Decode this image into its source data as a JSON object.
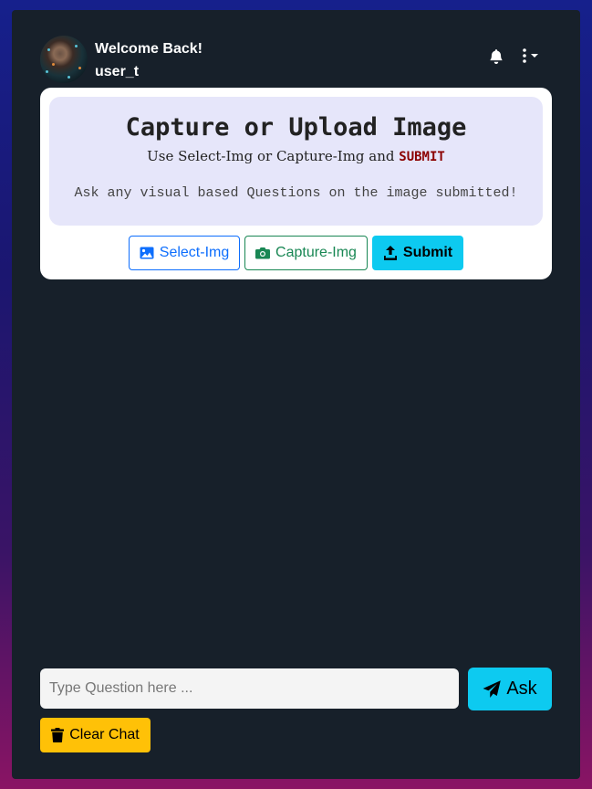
{
  "header": {
    "welcome": "Welcome Back!",
    "username": "user_t",
    "avatar_icon": "user-portrait-avatar",
    "notifications_icon": "bell-icon",
    "menu_icon": "kebab-dropdown-icon"
  },
  "card": {
    "title": "Capture or Upload Image",
    "subtitle_prefix": "Use Select-Img or Capture-Img and ",
    "subtitle_keyword": "SUBMIT",
    "hint": "Ask any visual based Questions on the image submitted!",
    "buttons": {
      "select": {
        "label": "Select-Img",
        "icon": "image-icon",
        "color": "#0d6efd"
      },
      "capture": {
        "label": "Capture-Img",
        "icon": "camera-icon",
        "color": "#198754"
      },
      "submit": {
        "label": "Submit",
        "icon": "upload-icon",
        "color": "#0dcaf0"
      }
    }
  },
  "chat": {
    "question_placeholder": "Type Question here ...",
    "question_value": "",
    "ask_label": "Ask",
    "ask_icon": "paper-plane-icon",
    "clear_label": "Clear Chat",
    "clear_icon": "trash-icon",
    "clear_color": "#ffc107"
  },
  "colors": {
    "panel_bg": "#17202a",
    "card_inner_bg": "#e6e6fa",
    "accent": "#0dcaf0"
  }
}
